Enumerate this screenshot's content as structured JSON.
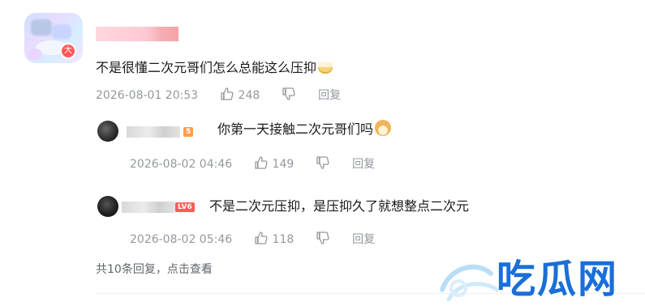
{
  "comment": {
    "avatar_badge": "大",
    "text": "不是很懂二次元哥们怎么总能这么压抑",
    "emoji": "bowl-emoji",
    "timestamp": "2026-08-01 20:53",
    "likes": "248",
    "reply_label": "回复"
  },
  "replies": [
    {
      "level": "5",
      "level_color": "#ff9d4d",
      "text": "你第一天接触二次元哥们吗",
      "emoji": "doge-emoji",
      "timestamp": "2026-08-02 04:46",
      "likes": "149",
      "reply_label": "回复"
    },
    {
      "level": "LV6",
      "level_color": "#ff5b5b",
      "text": "不是二次元压抑，是压抑久了就想整点二次元",
      "timestamp": "2026-08-02 05:46",
      "likes": "118",
      "reply_label": "回复"
    }
  ],
  "more_replies": "共10条回复，点击查看",
  "watermark": "吃瓜网",
  "colors": {
    "meta": "#9499a0",
    "text": "#18191c",
    "watermark": "#1a6fd8"
  }
}
